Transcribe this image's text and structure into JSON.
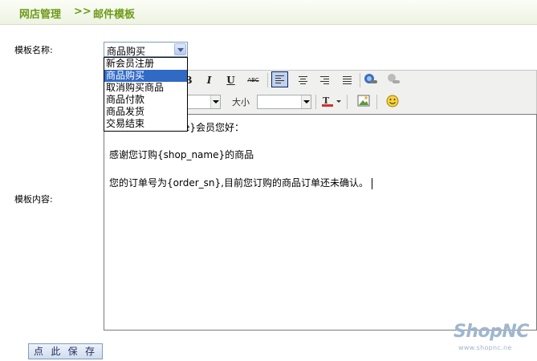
{
  "breadcrumb": {
    "part1": "网店管理",
    "separator": ">>",
    "part2": "邮件模板"
  },
  "form": {
    "template_name_label": "模板名称:",
    "template_content_label": "模板内容:",
    "selected_template": "商品购买",
    "options": [
      "新会员注册",
      "商品购买",
      "取消购买商品",
      "商品付款",
      "商品发货",
      "交易结束"
    ],
    "selected_index": 1,
    "save_label": "点 此 保 存"
  },
  "toolbar": {
    "italic": "I",
    "underline": "U",
    "strike": "ABC",
    "size_label": "大小"
  },
  "editor": {
    "lines": [
      "e}会员您好：",
      "感谢您订购{shop_name}的商品",
      "您的订单号为{order_sn},目前您订购的商品订单还未确认。"
    ]
  },
  "watermark": {
    "logo": "ShopNC",
    "url": "www.shopnc.ne"
  },
  "colors": {
    "header_text": "#6e9a18",
    "selected_option": "#316ac5",
    "border": "#7f9db9"
  }
}
